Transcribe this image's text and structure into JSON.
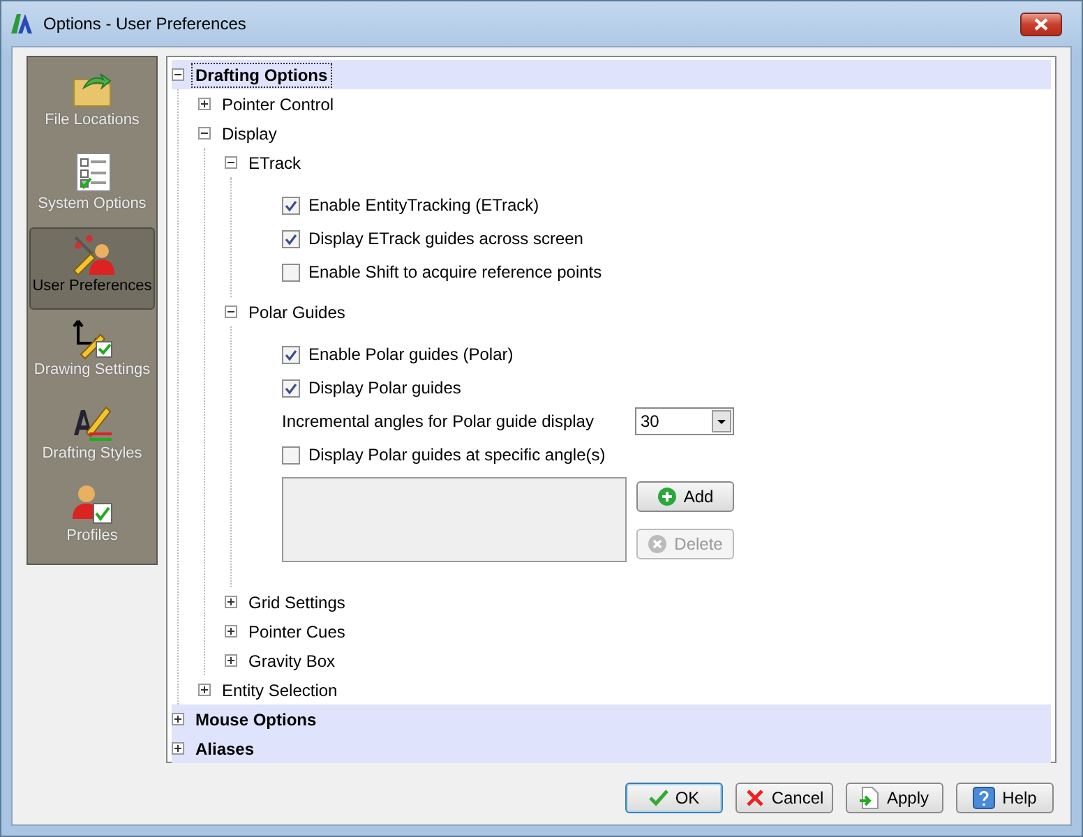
{
  "window": {
    "title": "Options - User Preferences"
  },
  "sidebar": {
    "items": [
      {
        "label": "File Locations",
        "selected": false
      },
      {
        "label": "System Options",
        "selected": false
      },
      {
        "label": "User Preferences",
        "selected": true
      },
      {
        "label": "Drawing Settings",
        "selected": false
      },
      {
        "label": "Drafting Styles",
        "selected": false
      },
      {
        "label": "Profiles",
        "selected": false
      }
    ]
  },
  "tree": [
    {
      "kind": "section",
      "label": "Drafting Options",
      "expanded": true,
      "selected": true,
      "children": [
        {
          "kind": "node",
          "label": "Pointer Control",
          "expanded": false
        },
        {
          "kind": "node",
          "label": "Display",
          "expanded": true,
          "children": [
            {
              "kind": "node",
              "label": "ETrack",
              "expanded": true,
              "children": [
                {
                  "kind": "checkbox",
                  "label": "Enable EntityTracking (ETrack)",
                  "checked": true
                },
                {
                  "kind": "checkbox",
                  "label": "Display ETrack guides across screen",
                  "checked": true
                },
                {
                  "kind": "checkbox",
                  "label": "Enable Shift to acquire reference points",
                  "checked": false
                }
              ]
            },
            {
              "kind": "node",
              "label": "Polar Guides",
              "expanded": true,
              "children": [
                {
                  "kind": "checkbox",
                  "label": "Enable Polar guides (Polar)",
                  "checked": true
                },
                {
                  "kind": "checkbox",
                  "label": "Display Polar guides",
                  "checked": true
                },
                {
                  "kind": "dropdown",
                  "label": "Incremental angles for Polar guide display",
                  "value": "30"
                },
                {
                  "kind": "checkbox",
                  "label": "Display Polar guides at specific angle(s)",
                  "checked": false
                },
                {
                  "kind": "list",
                  "buttons": [
                    {
                      "label": "Add",
                      "disabled": false
                    },
                    {
                      "label": "Delete",
                      "disabled": true
                    }
                  ]
                }
              ]
            },
            {
              "kind": "node",
              "label": "Grid Settings",
              "expanded": false
            },
            {
              "kind": "node",
              "label": "Pointer Cues",
              "expanded": false
            },
            {
              "kind": "node",
              "label": "Gravity Box",
              "expanded": false
            }
          ]
        },
        {
          "kind": "node",
          "label": "Entity Selection",
          "expanded": false
        }
      ]
    },
    {
      "kind": "section",
      "label": "Mouse Options",
      "expanded": false,
      "selected": false
    },
    {
      "kind": "section",
      "label": "Aliases",
      "expanded": false,
      "selected": false
    }
  ],
  "buttons": [
    {
      "label": "OK",
      "default": true
    },
    {
      "label": "Cancel",
      "default": false
    },
    {
      "label": "Apply",
      "default": false
    },
    {
      "label": "Help",
      "default": false
    }
  ]
}
